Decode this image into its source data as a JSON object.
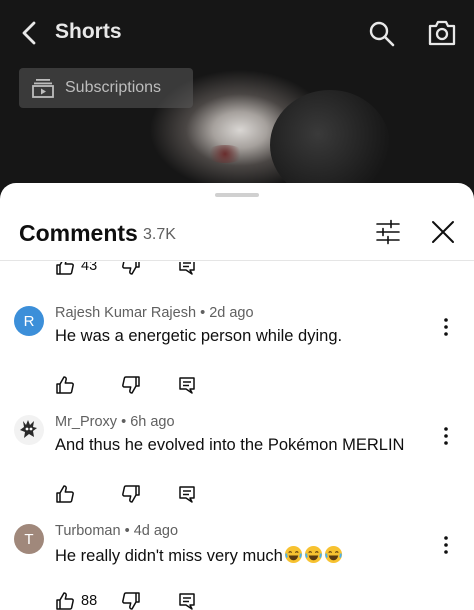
{
  "header": {
    "title": "Shorts"
  },
  "subscriptions_chip": {
    "label": "Subscriptions"
  },
  "comments_panel": {
    "title": "Comments",
    "count": "3.7K",
    "partial_row_likes": "43"
  },
  "comments": [
    {
      "avatar_letter": "R",
      "avatar_color": "#3c8fd9",
      "author": "Rajesh Kumar Rajesh",
      "time": "2d ago",
      "text": "He was a energetic person while dying.",
      "likes": ""
    },
    {
      "avatar_letter": "",
      "avatar_color": "#ffffff",
      "author": "Mr_Proxy",
      "time": "6h ago",
      "text": "And thus he evolved into the Pokémon MERLIN",
      "likes": ""
    },
    {
      "avatar_letter": "T",
      "avatar_color": "#a0887b",
      "author": "Turboman",
      "time": "4d ago",
      "text": "He really didn't miss very much",
      "likes": "88",
      "emoji": "😂😂😂"
    }
  ],
  "icons": {
    "back": "chevron-left-icon",
    "search": "search-icon",
    "camera": "camera-icon",
    "subscriptions": "subscriptions-icon",
    "filter": "filter-icon",
    "close": "close-icon",
    "like": "thumbs-up-icon",
    "dislike": "thumbs-down-icon",
    "reply": "reply-icon",
    "more": "more-vertical-icon"
  }
}
